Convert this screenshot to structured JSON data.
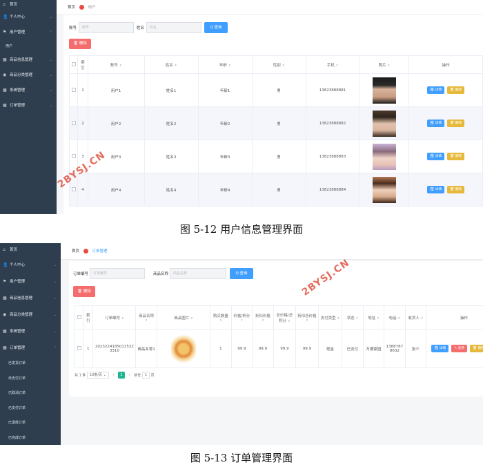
{
  "fig1": {
    "sidebar": {
      "items": [
        {
          "label": "首页",
          "icon": "home-icon"
        },
        {
          "label": "个人中心",
          "icon": "user-icon"
        },
        {
          "label": "用户管理",
          "icon": "flag-icon"
        },
        {
          "label": "商品信息管理",
          "icon": "grid-icon"
        },
        {
          "label": "商品分类管理",
          "icon": "location-icon"
        },
        {
          "label": "系统管理",
          "icon": "grid-icon"
        },
        {
          "label": "订单管理",
          "icon": "grid-icon"
        }
      ],
      "sub_user": "用户"
    },
    "breadcrumb": {
      "home": "首页",
      "current": "用户"
    },
    "search": {
      "account_label": "账号",
      "account_placeholder": "账号",
      "name_label": "姓名",
      "name_placeholder": "姓名",
      "query_button": "Q 查询"
    },
    "delete_button": "🗑 删除",
    "table": {
      "headers": [
        "索引",
        "账号",
        "姓名",
        "年龄",
        "性别",
        "手机",
        "照片",
        "操作"
      ],
      "rows": [
        {
          "index": "1",
          "account": "用户1",
          "name": "姓名1",
          "age": "年龄1",
          "gender": "男",
          "phone": "13823888881"
        },
        {
          "index": "2",
          "account": "用户2",
          "name": "姓名2",
          "age": "年龄2",
          "gender": "男",
          "phone": "13823888882"
        },
        {
          "index": "3",
          "account": "用户3",
          "name": "姓名3",
          "age": "年龄3",
          "gender": "男",
          "phone": "13823888883"
        },
        {
          "index": "4",
          "account": "用户4",
          "name": "姓名4",
          "age": "年龄4",
          "gender": "男",
          "phone": "13823888884"
        }
      ],
      "detail_button": "🗒 详情",
      "row_delete_button": "🗑 删除"
    },
    "watermark": "2BYSJ.CN"
  },
  "caption1": "图 5-12 用户信息管理界面",
  "fig2": {
    "sidebar": {
      "items": [
        {
          "label": "首页",
          "icon": "home-icon"
        },
        {
          "label": "个人中心",
          "icon": "user-icon"
        },
        {
          "label": "用户管理",
          "icon": "flag-icon"
        },
        {
          "label": "商品信息管理",
          "icon": "grid-icon"
        },
        {
          "label": "商品分类管理",
          "icon": "location-icon"
        },
        {
          "label": "系统管理",
          "icon": "grid-icon"
        },
        {
          "label": "订单管理",
          "icon": "grid-icon"
        }
      ],
      "sub_orders": [
        "已发货订单",
        "未支付订单",
        "已取消订单",
        "已支付订单",
        "已退款订单",
        "已完成订单"
      ]
    },
    "breadcrumb": {
      "home": "首页",
      "current": "订单管理"
    },
    "search": {
      "order_label": "订单编号",
      "order_placeholder": "订单编号",
      "product_label": "商品名称",
      "product_placeholder": "商品名称",
      "query_button": "Q 查询"
    },
    "delete_button": "🗑 删除",
    "table": {
      "headers": [
        "索引",
        "订单编号",
        "商品名称",
        "商品图片",
        "购买数量",
        "价格/积分",
        "折扣价格",
        "总价格/总积分",
        "折扣总价格",
        "支付类型",
        "状态",
        "地址",
        "电话",
        "收货人",
        "操作"
      ],
      "row": {
        "index": "1",
        "order_no": "2023224185011532 3310",
        "product": "商品名称1",
        "qty": "1",
        "price": "99.9",
        "discount": "99.9",
        "total": "99.9",
        "discount_total": "99.9",
        "pay_type": "现金",
        "status": "已支付",
        "address": "万德家园",
        "phone": "13887878632",
        "receiver": "张三"
      },
      "detail_button": "🗒 详情",
      "ship_button": "✎ 发货",
      "row_delete_button": "🗑 删除"
    },
    "pager": {
      "total": "共 1 条",
      "size": "10条/页",
      "page": "1",
      "goto": "前往",
      "goto_value": "1",
      "unit": "页"
    },
    "watermark": "2BYSJ.CN"
  },
  "caption2": "图 5-13 订单管理界面"
}
